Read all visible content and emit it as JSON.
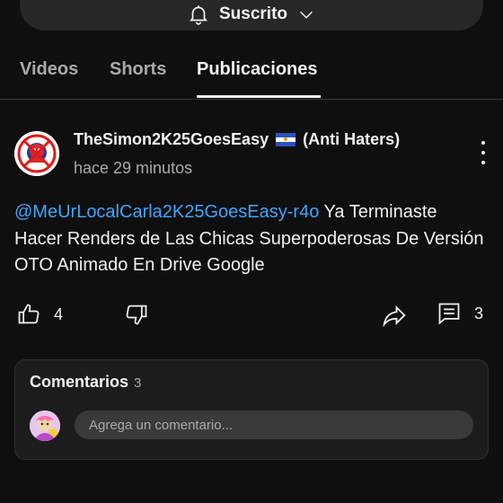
{
  "subscribe": {
    "label": "Suscrito",
    "icons": [
      "bell-icon",
      "chevron-down-icon"
    ]
  },
  "tabs": [
    {
      "label": "Videos",
      "active": false
    },
    {
      "label": "Shorts",
      "active": false
    },
    {
      "label": "Publicaciones",
      "active": true
    }
  ],
  "post": {
    "author": "TheSimon2K25GoesEasy",
    "author_suffix": "(Anti Haters)",
    "flag_icon": "el-salvador-flag-icon",
    "time": "hace 29 minutos",
    "mention": "@MeUrLocalCarla2K25GoesEasy-r4o",
    "text": " Ya Terminaste Hacer Renders de Las Chicas Superpoderosas De Versión OTO Animado En Drive Google",
    "likes": "4",
    "comments": "3"
  },
  "comments_section": {
    "title": "Comentarios",
    "count": "3",
    "placeholder": "Agrega un comentario..."
  },
  "colors": {
    "background": "#0f0f0f",
    "accent_link": "#3ea6ff",
    "card": "#1c1c1c"
  }
}
